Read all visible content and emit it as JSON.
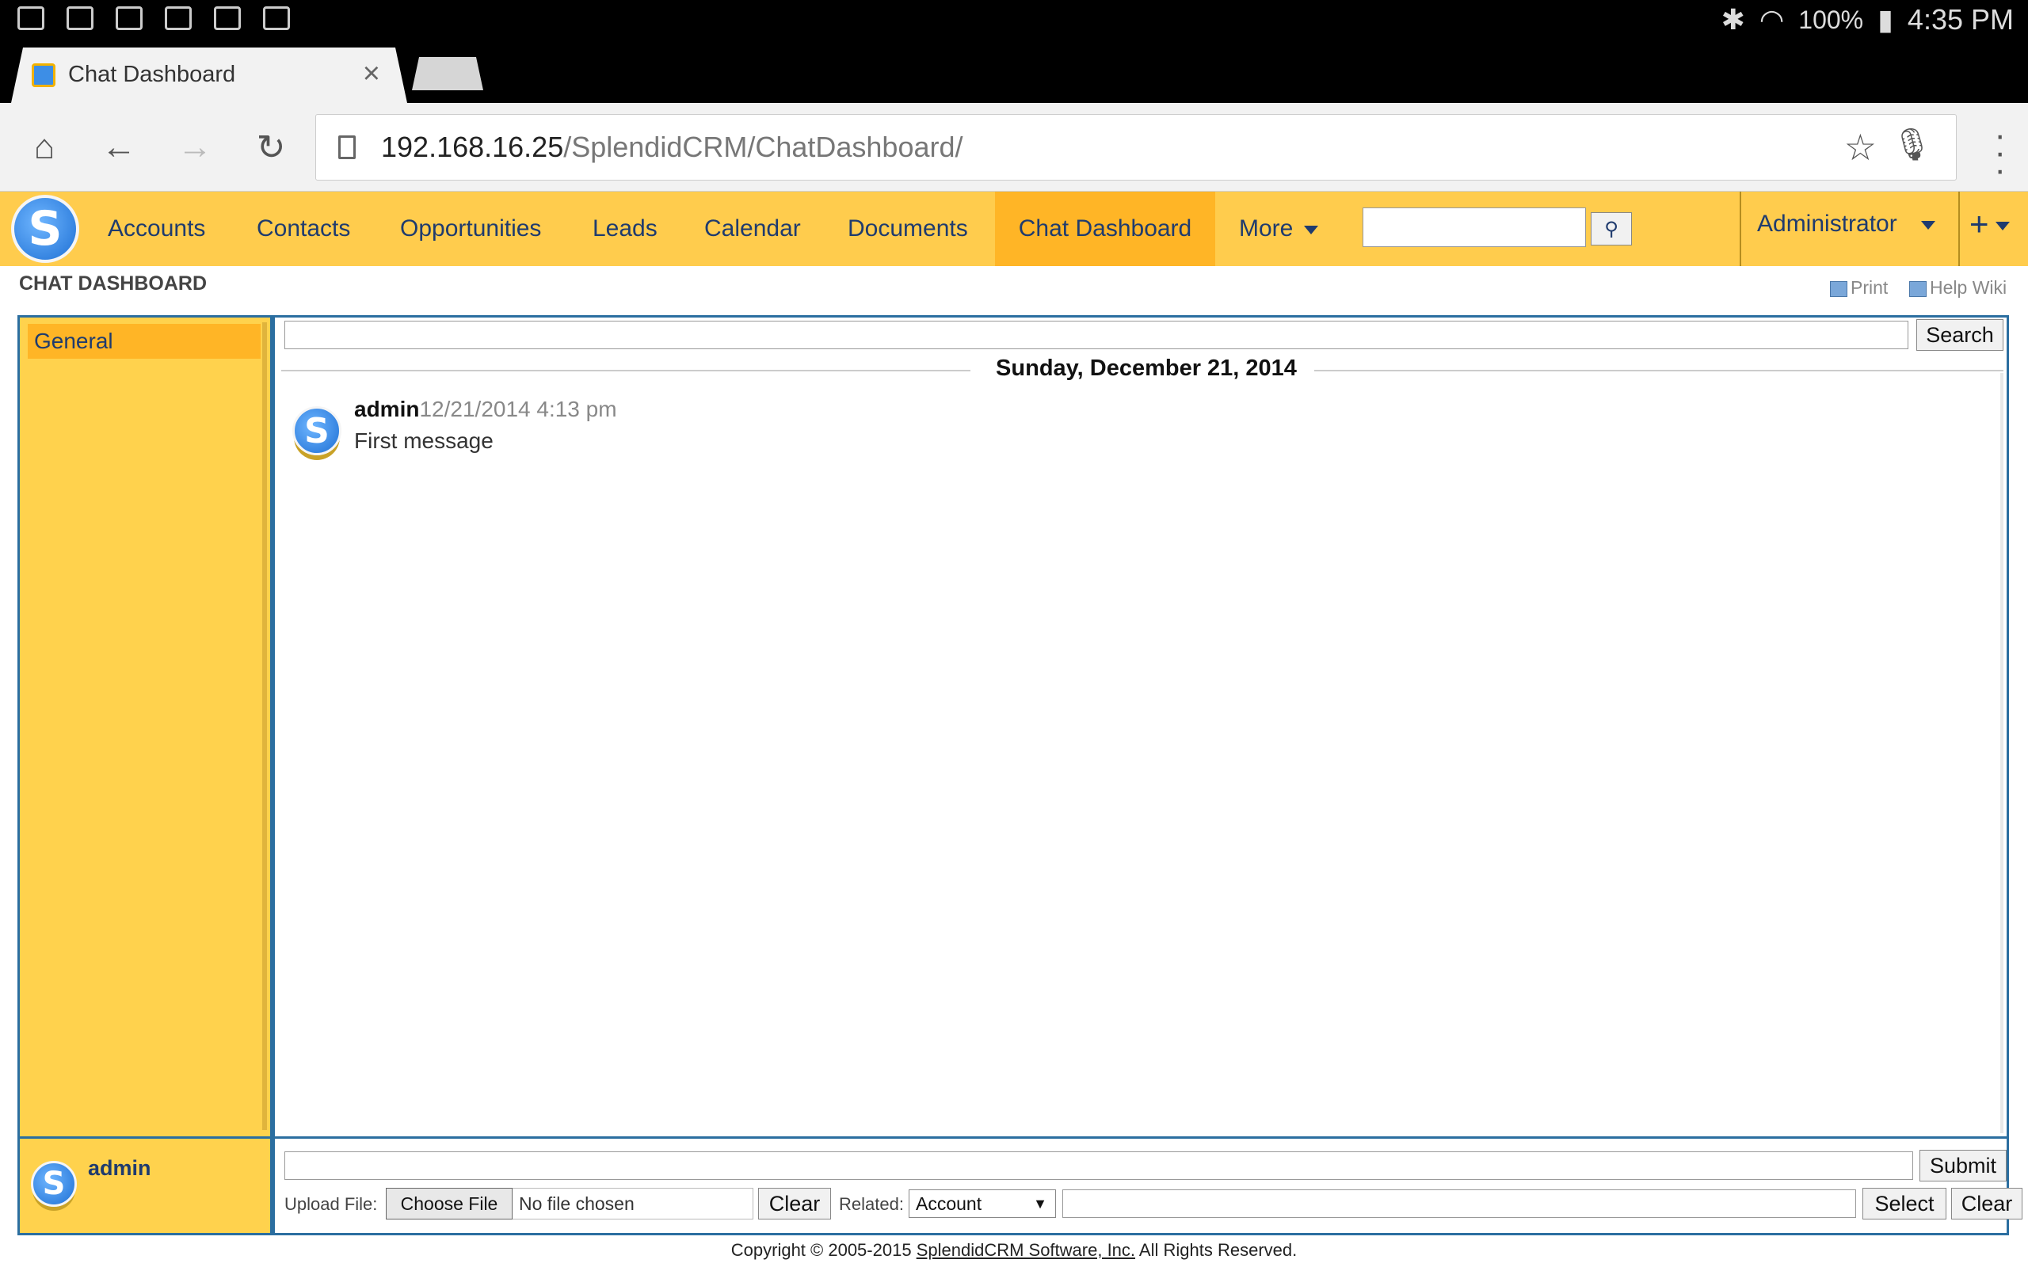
{
  "status_bar": {
    "battery": "100%",
    "time": "4:35 PM"
  },
  "browser": {
    "tab_title": "Chat Dashboard",
    "url_host": "192.168.16.25",
    "url_path": "/SplendidCRM/ChatDashboard/"
  },
  "nav": {
    "items": [
      "Accounts",
      "Contacts",
      "Opportunities",
      "Leads",
      "Calendar",
      "Documents",
      "Chat Dashboard",
      "More"
    ],
    "active": "Chat Dashboard",
    "user_menu": "Administrator",
    "plus": "+"
  },
  "page": {
    "title": "CHAT DASHBOARD",
    "print": "Print",
    "help": "Help Wiki"
  },
  "sidebar": {
    "channels": [
      "General"
    ]
  },
  "chat": {
    "search_label": "Search",
    "date_divider": "Sunday, December 21, 2014",
    "messages": [
      {
        "user": "admin",
        "time": "12/21/2014 4:13 pm",
        "text": "First message"
      }
    ]
  },
  "userbox": {
    "name": "admin"
  },
  "composer": {
    "submit": "Submit",
    "upload_label": "Upload File:",
    "choose_file": "Choose File",
    "file_status": "No file chosen",
    "clear": "Clear",
    "related_label": "Related:",
    "related_value": "Account",
    "select": "Select",
    "clear2": "Clear"
  },
  "footer": {
    "prefix": "Copyright © 2005-2015 ",
    "link": "SplendidCRM Software, Inc.",
    "suffix": " All Rights Reserved."
  }
}
